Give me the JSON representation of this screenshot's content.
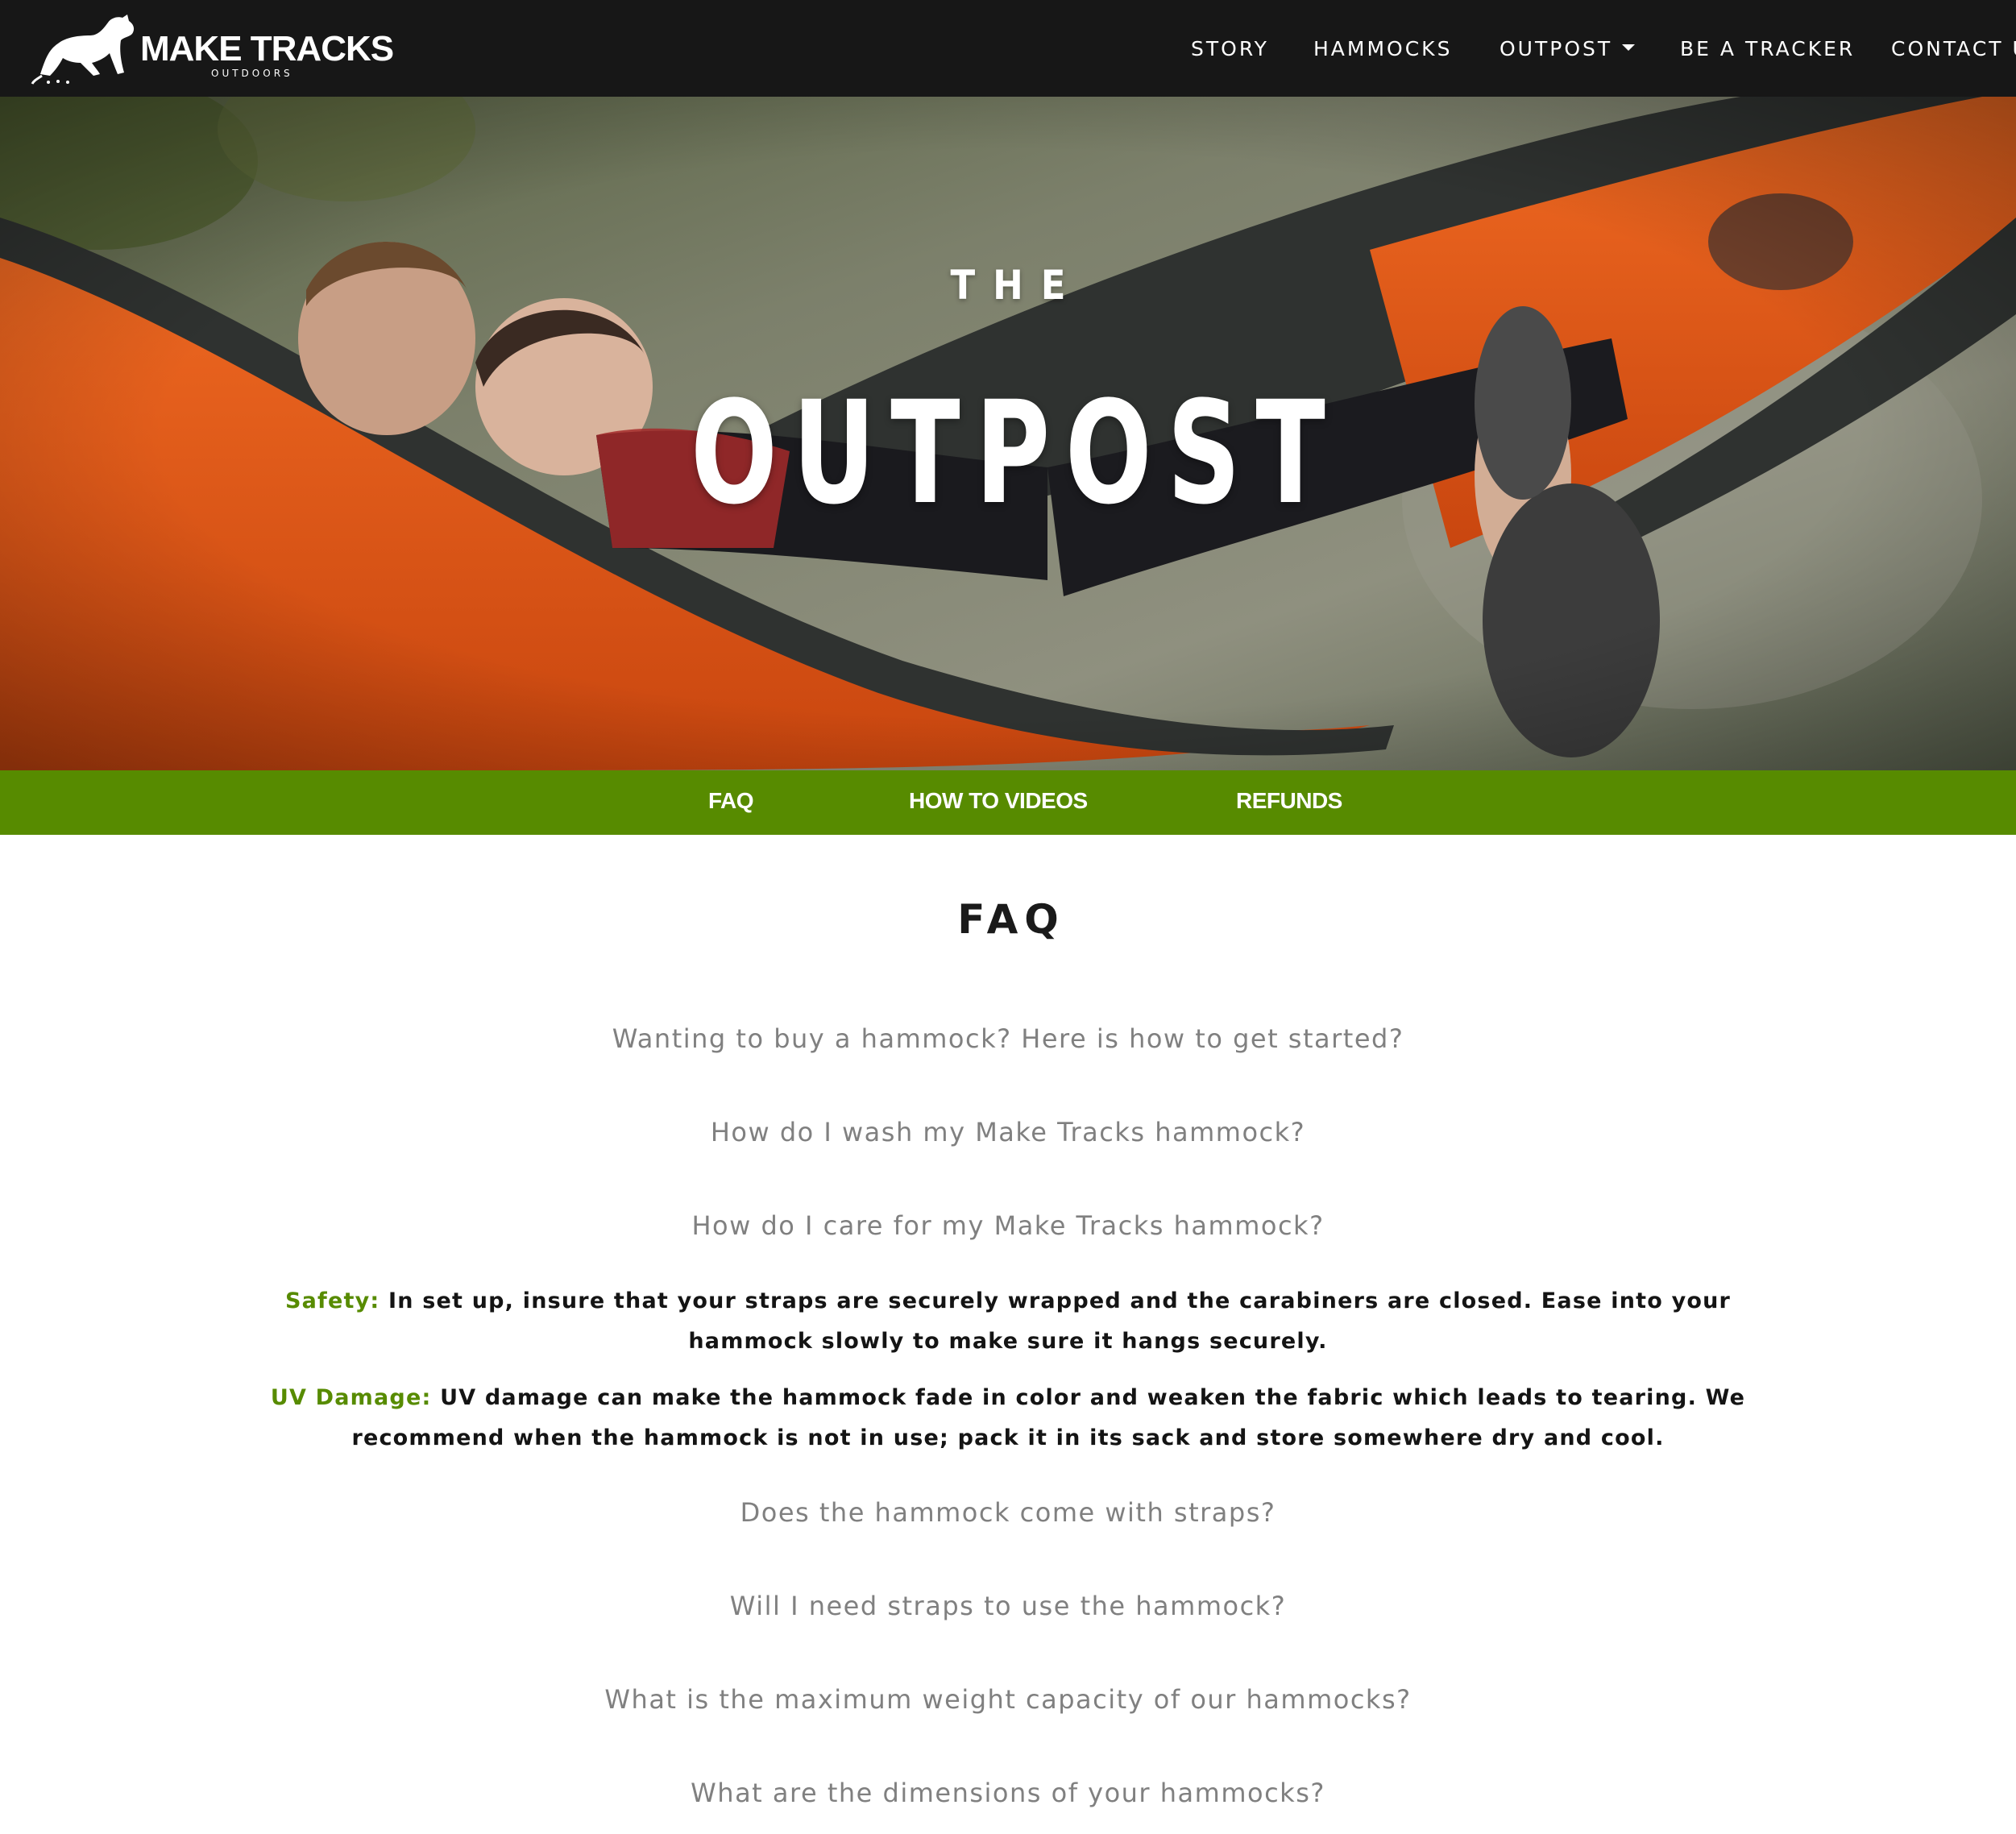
{
  "brand": {
    "name": "MAKE TRACKS",
    "sub": "OUTDOORS"
  },
  "nav": {
    "items": [
      {
        "label": "STORY"
      },
      {
        "label": "HAMMOCKS"
      },
      {
        "label": "OUTPOST"
      },
      {
        "label": "BE A TRACKER"
      },
      {
        "label": "CONTACT U"
      }
    ]
  },
  "hero": {
    "subtitle": "THE",
    "title": "OUTPOST"
  },
  "subnav": {
    "items": [
      {
        "label": "FAQ"
      },
      {
        "label": "HOW TO VIDEOS"
      },
      {
        "label": "REFUNDS"
      }
    ]
  },
  "faq": {
    "heading": "FAQ",
    "questions": [
      "Wanting to buy a hammock? Here is how to get started?",
      "How do I wash my Make Tracks hammock?",
      "How do I care for my Make Tracks hammock?",
      "Does the hammock come with straps?",
      "Will I need straps to use the hammock?",
      "What is the maximum weight capacity of our hammocks?",
      "What are the dimensions of your hammocks?"
    ],
    "answers": [
      {
        "label": "Safety:",
        "text": " In set up, insure that your straps are securely wrapped and the carabiners are closed. Ease into your hammock slowly to make sure it hangs securely."
      },
      {
        "label": "UV Damage:",
        "text": " UV damage can make the hammock fade in color and weaken the fabric which leads to tearing. We recommend when the hammock is not in use; pack it in its sack and store somewhere dry and cool."
      }
    ]
  },
  "colors": {
    "navbar": "#171717",
    "accent_green": "#578b00",
    "question_gray": "#808080",
    "hammock_orange": "#e4541a",
    "hammock_gray": "#2e3130"
  }
}
